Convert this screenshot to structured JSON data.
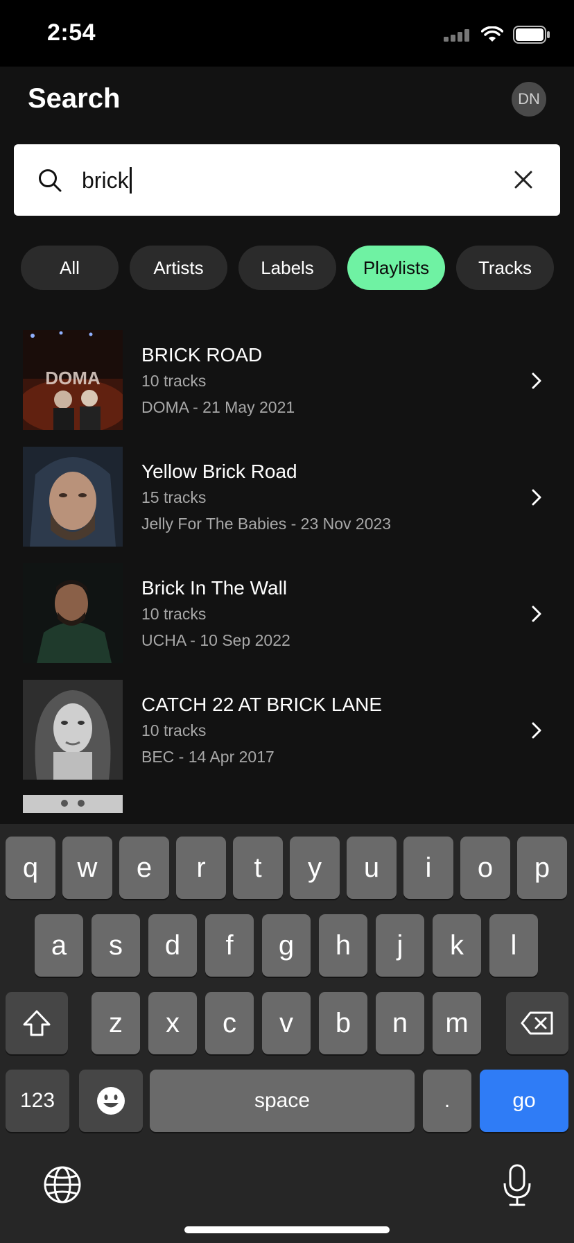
{
  "status_bar": {
    "time": "2:54"
  },
  "header": {
    "title": "Search",
    "avatar_initials": "DN"
  },
  "search": {
    "value": "brick"
  },
  "filters": [
    {
      "label": "All",
      "active": false
    },
    {
      "label": "Artists",
      "active": false
    },
    {
      "label": "Labels",
      "active": false
    },
    {
      "label": "Playlists",
      "active": true
    },
    {
      "label": "Tracks",
      "active": false
    }
  ],
  "results": [
    {
      "title": "BRICK ROAD",
      "count": "10 tracks",
      "meta": "DOMA - 21 May 2021",
      "thumb_text": "DOMA"
    },
    {
      "title": "Yellow Brick Road",
      "count": "15 tracks",
      "meta": "Jelly For The Babies - 23 Nov 2023"
    },
    {
      "title": "Brick In The Wall",
      "count": "10 tracks",
      "meta": "UCHA - 10 Sep 2022"
    },
    {
      "title": "CATCH 22 AT BRICK LANE",
      "count": "10 tracks",
      "meta": "BEC - 14 Apr 2017"
    }
  ],
  "keyboard": {
    "row1": [
      "q",
      "w",
      "e",
      "r",
      "t",
      "y",
      "u",
      "i",
      "o",
      "p"
    ],
    "row2": [
      "a",
      "s",
      "d",
      "f",
      "g",
      "h",
      "j",
      "k",
      "l"
    ],
    "row3": [
      "z",
      "x",
      "c",
      "v",
      "b",
      "n",
      "m"
    ],
    "numbers_label": "123",
    "space_label": "space",
    "period_label": ".",
    "go_label": "go"
  },
  "colors": {
    "accent": "#6ff2a3",
    "go_key": "#2f7cf6",
    "background": "#121212"
  }
}
